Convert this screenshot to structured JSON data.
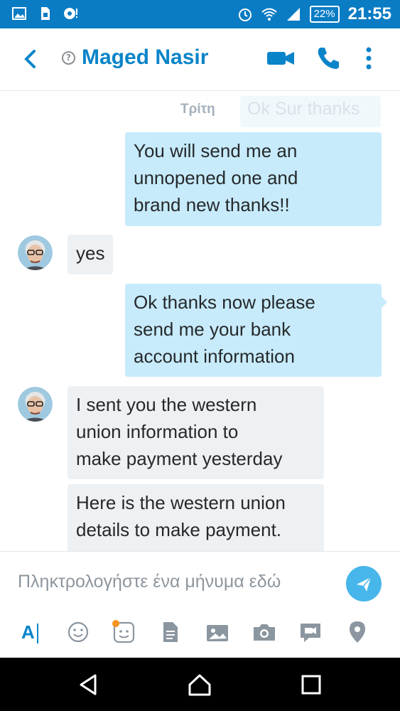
{
  "status_bar": {
    "battery": "22%",
    "time": "21:55",
    "icons": [
      "image-icon",
      "sim-icon",
      "sync-icon",
      "alarm-icon",
      "wifi-icon",
      "signal-icon",
      "battery-icon"
    ]
  },
  "header": {
    "contact_name": "Maged Nasir",
    "status_glyph": "?",
    "icons": [
      "back-icon",
      "video-call-icon",
      "phone-call-icon",
      "more-vertical-icon"
    ]
  },
  "chat": {
    "date_label": "Τρίτη",
    "faded_message": "Ok Sur thanks",
    "messages": [
      {
        "direction": "outgoing",
        "text": "You will send me  an\nunnopened one and\nbrand new thanks!!"
      },
      {
        "direction": "incoming",
        "text": "yes"
      },
      {
        "direction": "outgoing",
        "text": "Ok thanks now please\nsend  me your bank\naccount information"
      },
      {
        "direction": "incoming",
        "text": "I sent you the western\nunion information to\nmake payment yesterday"
      },
      {
        "direction": "incoming",
        "text": "Here is the western union\ndetails to make payment."
      }
    ]
  },
  "composer": {
    "placeholder": "Πληκτρολογήστε ένα μήνυμα εδώ",
    "text_tool_label": "A",
    "tools": [
      "text-format-icon",
      "emoji-icon",
      "moji-icon",
      "file-icon",
      "media-icon",
      "camera-icon",
      "video-message-icon",
      "location-icon"
    ]
  },
  "colors": {
    "brand": "#0a84c9",
    "status_bar": "#0a7cc4",
    "outgoing_bubble": "#c7ebfb",
    "incoming_bubble": "#eef1f4",
    "send_button": "#47b6ea",
    "notification_dot": "#f7931e"
  }
}
